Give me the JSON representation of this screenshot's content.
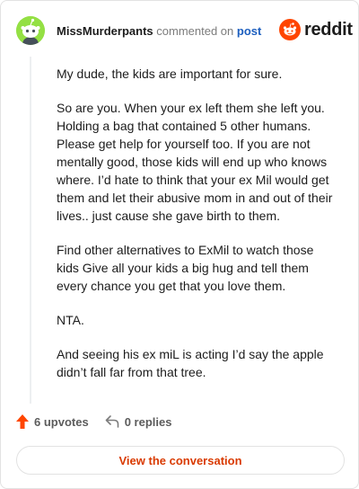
{
  "header": {
    "username": "MissMurderpants",
    "action_text": "commented on",
    "post_link": "post",
    "avatar_icon": "snoo-avatar-icon",
    "avatar_color": "#94e044"
  },
  "brand": {
    "name": "reddit",
    "icon": "reddit-snoo-logo-icon",
    "color": "#ff4500"
  },
  "comment": {
    "paragraphs": [
      "My dude, the kids are important for sure.",
      "So are you. When your ex left them she left you. Holding a bag that contained 5 other humans. Please get help for yourself too. If you are not mentally good, those kids will end up who knows where. I’d hate to think that your ex Mil would get them and let their abusive mom in and out of their lives.. just cause she gave birth to them.",
      "Find other alternatives to ExMil to watch those kids Give all your kids a big hug and tell them every chance you get that you love them.",
      "NTA.",
      "And seeing his ex miL is acting I’d say the apple didn’t fall far from that tree."
    ]
  },
  "actions": {
    "upvotes": "6 upvotes",
    "upvote_icon": "upvote-arrow-icon",
    "upvote_color": "#ff4500",
    "replies": "0 replies",
    "reply_icon": "reply-arrow-icon"
  },
  "footer": {
    "view_label": "View the conversation",
    "accent": "#d93a00"
  }
}
